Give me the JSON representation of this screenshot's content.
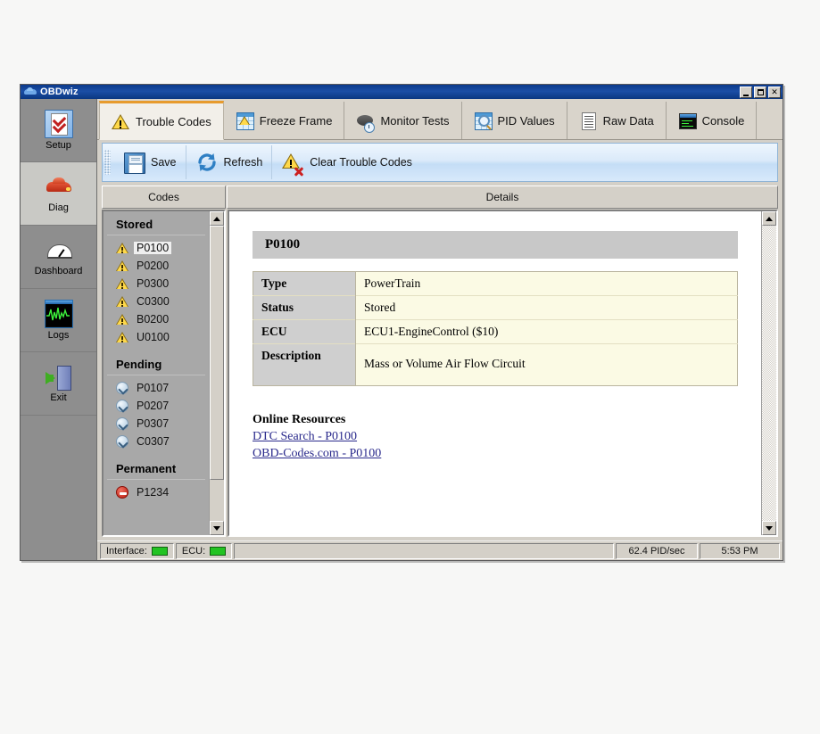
{
  "window": {
    "title": "OBDwiz",
    "title_icon": "car-icon",
    "buttons": {
      "minimize": "minimize-button",
      "maximize": "maximize-button",
      "close": "✕"
    }
  },
  "sidebar": {
    "items": [
      {
        "label": "Setup",
        "icon": "checklist-icon",
        "selected": false
      },
      {
        "label": "Diag",
        "icon": "car-icon",
        "selected": true
      },
      {
        "label": "Dashboard",
        "icon": "gauge-icon",
        "selected": false
      },
      {
        "label": "Logs",
        "icon": "waveform-icon",
        "selected": false
      },
      {
        "label": "Exit",
        "icon": "exit-door-icon",
        "selected": false
      }
    ]
  },
  "tabs": [
    {
      "label": "Trouble Codes",
      "icon": "warning-triangle-icon",
      "active": true
    },
    {
      "label": "Freeze Frame",
      "icon": "grid-warning-icon",
      "active": false
    },
    {
      "label": "Monitor Tests",
      "icon": "puck-clock-icon",
      "active": false
    },
    {
      "label": "PID Values",
      "icon": "grid-magnifier-icon",
      "active": false
    },
    {
      "label": "Raw Data",
      "icon": "document-icon",
      "active": false
    },
    {
      "label": "Console",
      "icon": "console-window-icon",
      "active": false
    }
  ],
  "toolbar": {
    "save_label": "Save",
    "refresh_label": "Refresh",
    "clear_label": "Clear Trouble Codes"
  },
  "columns": {
    "codes_header": "Codes",
    "details_header": "Details"
  },
  "codes": {
    "groups": [
      {
        "title": "Stored",
        "icon": "warning-triangle-icon",
        "items": [
          {
            "code": "P0100",
            "selected": true
          },
          {
            "code": "P0200",
            "selected": false
          },
          {
            "code": "P0300",
            "selected": false
          },
          {
            "code": "C0300",
            "selected": false
          },
          {
            "code": "B0200",
            "selected": false
          },
          {
            "code": "U0100",
            "selected": false
          }
        ]
      },
      {
        "title": "Pending",
        "icon": "chevron-down-circle-icon",
        "items": [
          {
            "code": "P0107",
            "selected": false
          },
          {
            "code": "P0207",
            "selected": false
          },
          {
            "code": "P0307",
            "selected": false
          },
          {
            "code": "C0307",
            "selected": false
          }
        ]
      },
      {
        "title": "Permanent",
        "icon": "red-minus-circle-icon",
        "items": [
          {
            "code": "P1234",
            "selected": false
          }
        ]
      }
    ]
  },
  "details": {
    "code_title": "P0100",
    "rows": [
      {
        "key": "Type",
        "value": "PowerTrain"
      },
      {
        "key": "Status",
        "value": "Stored"
      },
      {
        "key": "ECU",
        "value": "ECU1-EngineControl ($10)"
      },
      {
        "key": "Description",
        "value": "Mass or Volume Air Flow Circuit"
      }
    ],
    "resources_heading": "Online Resources",
    "links": [
      "DTC Search - P0100",
      "OBD-Codes.com - P0100"
    ]
  },
  "statusbar": {
    "interface_label": "Interface:",
    "interface_state": "#22c322",
    "ecu_label": "ECU:",
    "ecu_state": "#22c322",
    "pid_rate": "62.4 PID/sec",
    "time": "5:53 PM"
  },
  "colors": {
    "titlebar": "#0b3a8c",
    "window_face": "#d4d0c8",
    "sidebar": "#8e8e8e",
    "active_tab_accent": "#e79b2e",
    "detail_table_bg": "#fbfae4",
    "link": "#2a2a8c"
  }
}
